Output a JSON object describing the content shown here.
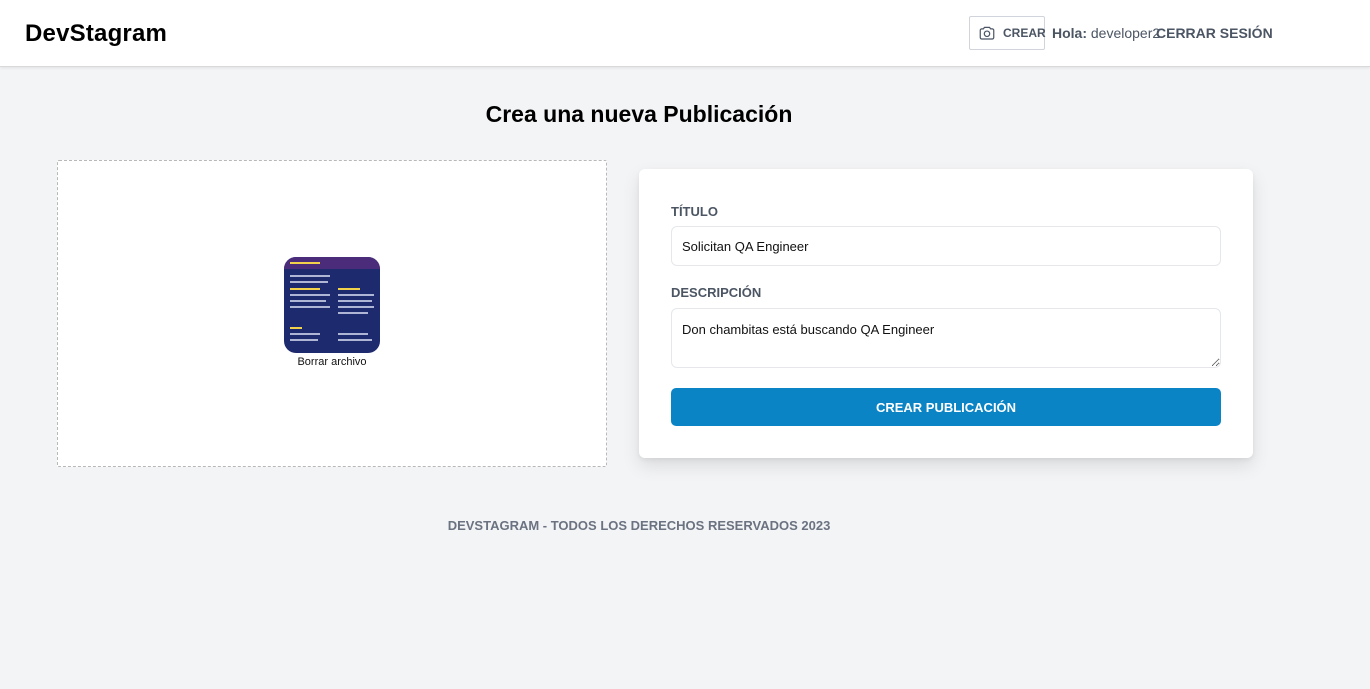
{
  "header": {
    "logo": "DevStagram",
    "create_label": "CREAR",
    "greeting_prefix": "Hola:",
    "username": "developer2",
    "logout_label": "CERRAR SESIÓN"
  },
  "main": {
    "title": "Crea una nueva Publicación",
    "dropzone": {
      "remove_label": "Borrar archivo"
    },
    "form": {
      "title_label": "Título",
      "title_value": "Solicitan QA Engineer",
      "description_label": "Descripción",
      "description_value": "Don chambitas está buscando QA Engineer",
      "submit_label": "Crear Publicación"
    }
  },
  "footer": {
    "text": "DEVSTAGRAM - TODOS LOS DERECHOS RESERVADOS 2023"
  },
  "colors": {
    "background": "#f3f4f6",
    "primary": "#0b84c6",
    "muted_text": "#4b5563"
  },
  "icons": {
    "create": "camera-icon"
  }
}
